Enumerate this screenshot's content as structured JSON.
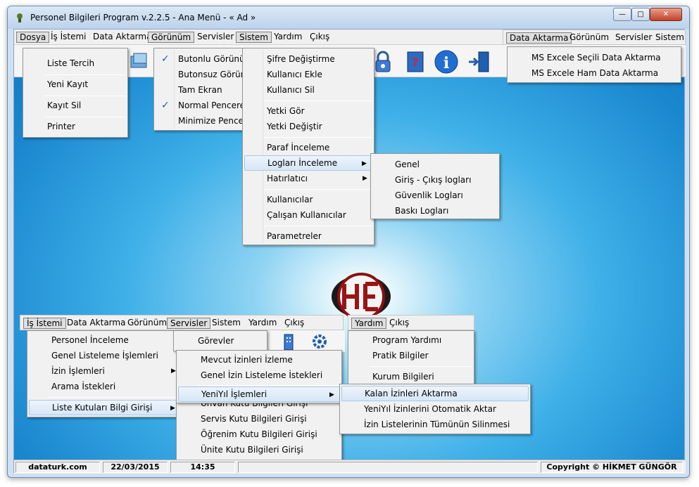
{
  "window": {
    "title": "Personel Bilgileri Program v.2.2.5  - Ana Menü -  « Ad »",
    "controls": {
      "minimize": "—",
      "maximize": "□",
      "close": "✕"
    }
  },
  "menubar": {
    "items": [
      "Dosya",
      "İş İstemi",
      "Data Aktarma",
      "Görünüm",
      "Servisler",
      "Sistem",
      "Yardım",
      "Çıkış"
    ]
  },
  "dosya_menu": [
    "Liste Tercih",
    "Yeni Kayıt",
    "Kayıt Sil",
    "Printer"
  ],
  "gorunum_menu": [
    {
      "label": "Butonlu Görünüm",
      "checked": true
    },
    {
      "label": "Butonsuz Görünüm",
      "checked": false
    },
    {
      "label": "Tam Ekran",
      "checked": false
    },
    {
      "label": "Normal Pencere",
      "checked": true
    },
    {
      "label": "Minimize Pencere",
      "checked": false
    }
  ],
  "sistem_menu": [
    "Şifre Değiştirme",
    "Kullanıcı Ekle",
    "Kullanıcı Sil",
    "Yetki Gör",
    "Yetki Değiştir",
    "Paraf İnceleme",
    "Logları İnceleme",
    "Hatırlatıcı",
    "Kullanıcılar",
    "Çalışan Kullanıcılar",
    "Parametreler"
  ],
  "loglar_submenu": [
    "Genel",
    "Giriş - Çıkış logları",
    "Güvenlik Logları",
    "Baskı Logları"
  ],
  "data_aktarma_bar": [
    "Data Aktarma",
    "Görünüm",
    "Servisler",
    "Sistem"
  ],
  "data_aktarma_menu": [
    "MS Excele Seçili Data Aktarma",
    "MS Excele Ham Data Aktarma"
  ],
  "lower_menubar": [
    "İş İstemi",
    "Data Aktarma",
    "Görünüm",
    "Servisler",
    "Sistem",
    "Yardım",
    "Çıkış"
  ],
  "is_istemi_menu": [
    "Personel İnceleme",
    "Genel Listeleme İşlemleri",
    "İzin İşlemleri",
    "Arama İstekleri",
    "Liste Kutuları Bilgi Girişi"
  ],
  "servisler_menu": [
    "Görevler"
  ],
  "izin_submenu": [
    "Mevcut İzinleri İzleme",
    "Genel İzin Listeleme İstekleri",
    "YeniYıl İşlemleri"
  ],
  "liste_kutulari_submenu": [
    "Ünvan Kutu Bilgileri Girişi",
    "Servis Kutu Bilgileri Girişi",
    "Öğrenim Kutu Bilgileri Girişi",
    "Ünite Kutu Bilgileri Girişi"
  ],
  "yeniyil_submenu": [
    "Kalan İzinleri Aktarma",
    "YeniYıl İzinlerini Otomatik Aktar",
    "İzin Listelerinin Tümünün Silinmesi"
  ],
  "yardim_bar": [
    "Yardım",
    "Çıkış"
  ],
  "yardim_menu": [
    "Program Yardımı",
    "Pratik Bilgiler",
    "Kurum Bilgileri"
  ],
  "statusbar": {
    "site": "dataturk.com",
    "date": "22/03/2015",
    "time": "14:35",
    "copyright": "Copyright © HİKMET GÜNGÖR"
  },
  "colors": {
    "accent": "#1a87cf",
    "highlight": "#d6e6f7",
    "check": "#1a5fb4"
  },
  "icons": [
    "app-icon",
    "toolbar-documents-icon",
    "lock-icon",
    "help-book-icon",
    "info-icon",
    "exit-door-icon",
    "company-logo-icon",
    "building-icon",
    "gear-network-icon"
  ]
}
